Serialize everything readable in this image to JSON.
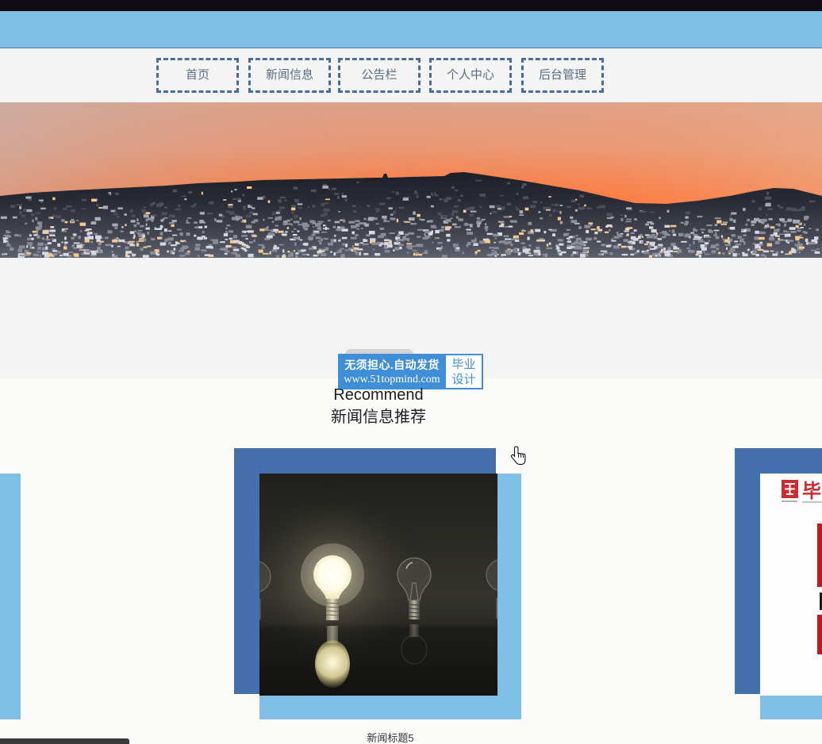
{
  "theme": {
    "header_bg": "#80bfe6",
    "header_border": "#4e7cb5",
    "nav_border": "#4a6d9f",
    "nav_text": "#5b6b84",
    "watermark_blue": "#3f8fd8",
    "frame_dark": "#4470ad",
    "frame_light": "#80bfe6"
  },
  "nav": {
    "items": [
      {
        "label": "首页"
      },
      {
        "label": "新闻信息"
      },
      {
        "label": "公告栏"
      },
      {
        "label": "个人中心"
      },
      {
        "label": "后台管理"
      }
    ]
  },
  "watermark": {
    "line1": "无须担心.自动发货",
    "line2": "www.51topmind.com",
    "tag_line1": "毕业",
    "tag_line2": "设计"
  },
  "recommend": {
    "title": "Recommend",
    "subtitle": "新闻信息推荐",
    "cards": [
      {},
      {
        "caption": "新闻标题5"
      },
      {
        "logo_text": "毕"
      }
    ]
  },
  "cursor": {
    "icon": "hand-pointer-icon"
  }
}
